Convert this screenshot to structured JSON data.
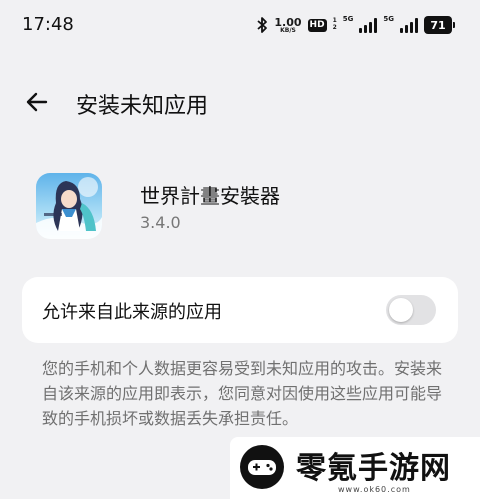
{
  "status_bar": {
    "time": "17:48",
    "net_speed": "1.00",
    "net_unit": "KB/S",
    "hd_label": "HD",
    "hd_sub_top": "1",
    "hd_sub_bottom": "2",
    "sim1_gen": "5G",
    "sim2_gen": "5G",
    "battery_level": "71",
    "icons": [
      "bluetooth-icon",
      "signal-icon",
      "battery-icon"
    ]
  },
  "header": {
    "title": "安装未知应用",
    "back_icon": "arrow-left-icon"
  },
  "app": {
    "name": "世界計畫安裝器",
    "version": "3.4.0"
  },
  "setting": {
    "label": "允许来自此来源的应用",
    "enabled": false
  },
  "warning": {
    "text": "您的手机和个人数据更容易受到未知应用的攻击。安装来自该来源的应用即表示，您同意对因使用这些应用可能导致的手机损坏或数据丢失承担责任。"
  },
  "watermark": {
    "brand": "零氪手游网",
    "url": "www.ok60.com"
  },
  "colors": {
    "background": "#f1f1f3",
    "card": "#ffffff",
    "toggle_off": "#e2e2e4",
    "secondary_text": "#707070"
  }
}
